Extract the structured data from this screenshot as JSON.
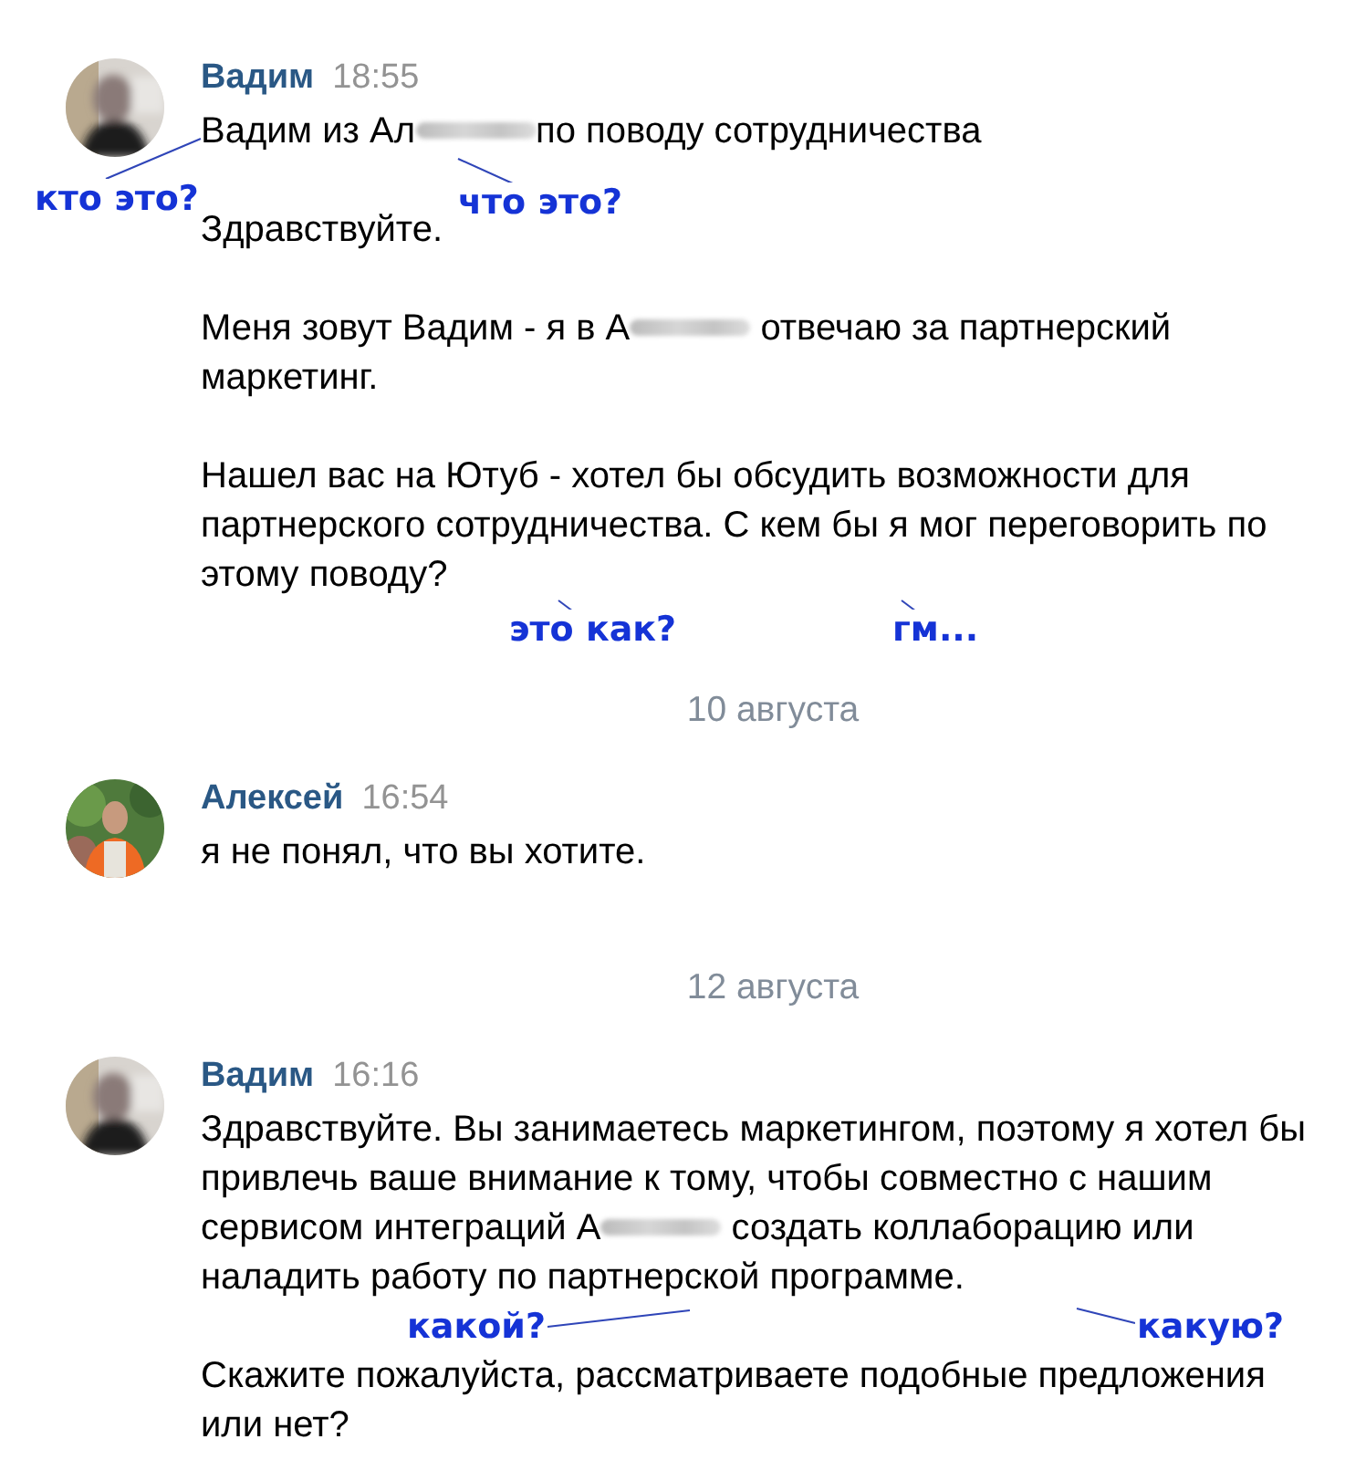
{
  "feed": [
    {
      "kind": "message",
      "author": "Вадим",
      "time": "18:55",
      "paragraphs": [
        [
          [
            {
              "kind": "text",
              "text": "Вадим из Ал"
            },
            {
              "kind": "blur"
            },
            {
              "kind": "text",
              "text": "по поводу сотрудничества"
            }
          ]
        ],
        [
          [
            {
              "kind": "text",
              "text": "Здравствуйте."
            }
          ]
        ],
        [
          [
            {
              "kind": "text",
              "text": "Меня зовут Вадим - я в А"
            },
            {
              "kind": "blur"
            },
            {
              "kind": "text",
              "text": " отвечаю за партнерский"
            }
          ],
          [
            {
              "kind": "text",
              "text": "маркетинг."
            }
          ]
        ],
        [
          [
            {
              "kind": "text",
              "text": "Нашел вас на Ютуб - хотел бы обсудить возможности для"
            }
          ],
          [
            {
              "kind": "text",
              "text": "партнерского сотрудничества. С кем бы я мог переговорить по"
            }
          ],
          [
            {
              "kind": "text",
              "text": "этому поводу?"
            }
          ]
        ]
      ]
    },
    {
      "kind": "date",
      "text": "10 августа"
    },
    {
      "kind": "message",
      "author": "Алексей",
      "time": "16:54",
      "paragraphs": [
        [
          [
            {
              "kind": "text",
              "text": "я не понял, что вы хотите."
            }
          ]
        ]
      ]
    },
    {
      "kind": "date",
      "text": "12 августа"
    },
    {
      "kind": "message",
      "author": "Вадим",
      "time": "16:16",
      "paragraphs": [
        [
          [
            {
              "kind": "text",
              "text": "Здравствуйте. Вы занимаетесь маркетингом, поэтому я хотел бы"
            }
          ],
          [
            {
              "kind": "text",
              "text": "привлечь ваше внимание к тому, чтобы совместно с нашим"
            }
          ],
          [
            {
              "kind": "text",
              "text": "сервисом интеграций А"
            },
            {
              "kind": "blur"
            },
            {
              "kind": "text",
              "text": " создать коллаборацию или"
            }
          ],
          [
            {
              "kind": "text",
              "text": "наладить работу по партнерской программе."
            }
          ]
        ],
        [
          [
            {
              "kind": "text",
              "text": "Скажите пожалуйста, рассматриваете подобные предложения"
            }
          ],
          [
            {
              "kind": "text",
              "text": "или нет?"
            }
          ]
        ]
      ]
    }
  ],
  "annotations": [
    {
      "text": "кто это?"
    },
    {
      "text": "что это?"
    },
    {
      "text": "это как?"
    },
    {
      "text": "гм..."
    },
    {
      "text": "какой?"
    },
    {
      "text": "какую?"
    }
  ]
}
